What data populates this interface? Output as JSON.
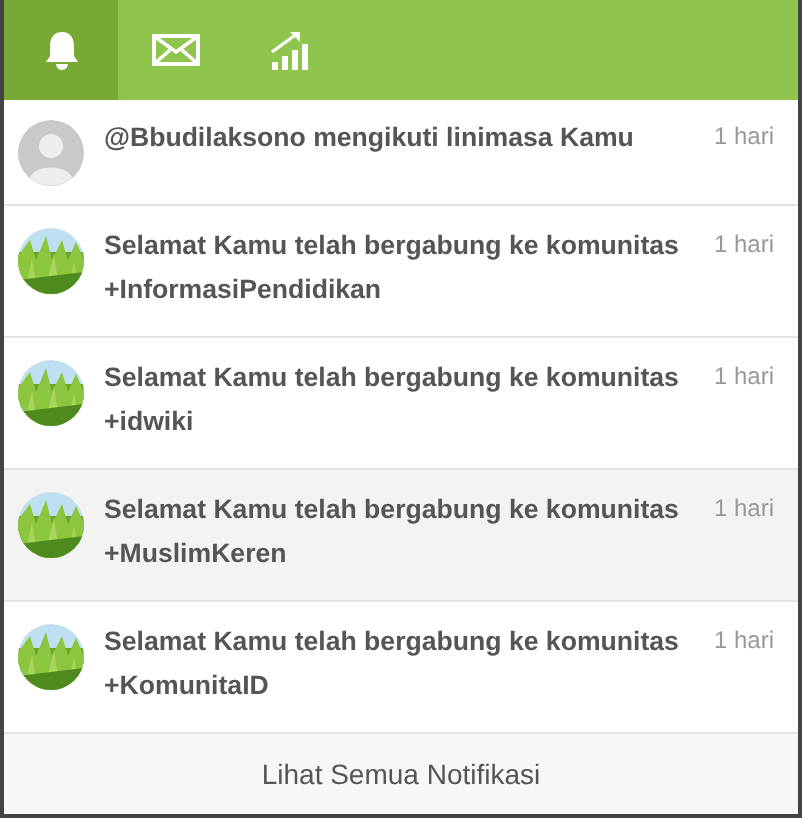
{
  "tabs": [
    {
      "kind": "bell",
      "selected": true
    },
    {
      "kind": "mail",
      "selected": false
    },
    {
      "kind": "chart",
      "selected": false
    }
  ],
  "notifications": [
    {
      "kind": "user",
      "text": "@Bbudilaksono mengikuti linimasa Kamu",
      "time": "1 hari",
      "selected": false
    },
    {
      "kind": "picture",
      "text": "Selamat Kamu telah bergabung ke komunitas +InformasiPendidikan",
      "time": "1 hari",
      "selected": false
    },
    {
      "kind": "picture",
      "text": "Selamat Kamu telah bergabung ke komunitas +idwiki",
      "time": "1 hari",
      "selected": false
    },
    {
      "kind": "picture",
      "text": "Selamat Kamu telah bergabung ke komunitas +MuslimKeren",
      "time": "1 hari",
      "selected": true
    },
    {
      "kind": "picture",
      "text": "Selamat Kamu telah bergabung ke komunitas +KomunitaID",
      "time": "1 hari",
      "selected": false
    }
  ],
  "footer": "Lihat Semua Notifikasi"
}
